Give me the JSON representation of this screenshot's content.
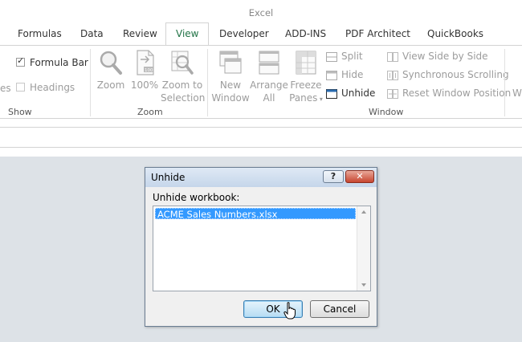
{
  "window": {
    "title": "Excel"
  },
  "tabs": [
    {
      "label": "Formulas"
    },
    {
      "label": "Data"
    },
    {
      "label": "Review"
    },
    {
      "label": "View",
      "active": true
    },
    {
      "label": "Developer"
    },
    {
      "label": "ADD-INS"
    },
    {
      "label": "PDF Architect"
    },
    {
      "label": "QuickBooks"
    }
  ],
  "ribbon": {
    "show": {
      "label": "Show",
      "partial_left": "es",
      "formula_bar": {
        "label": "Formula Bar",
        "checked": true
      },
      "headings": {
        "label": "Headings",
        "checked": false,
        "disabled": true
      }
    },
    "zoom": {
      "label": "Zoom",
      "zoom_btn": {
        "label": "Zoom",
        "icon": "magnifier-icon"
      },
      "hundred_btn": {
        "label": "100%",
        "icon": "zoom-100-icon"
      },
      "selection_btn": {
        "line1": "Zoom to",
        "line2": "Selection",
        "icon": "zoom-selection-icon"
      }
    },
    "window": {
      "label": "Window",
      "new_window": {
        "line1": "New",
        "line2": "Window"
      },
      "arrange_all": {
        "line1": "Arrange",
        "line2": "All"
      },
      "freeze_panes": {
        "line1": "Freeze",
        "line2": "Panes"
      },
      "split": "Split",
      "hide": "Hide",
      "unhide": "Unhide",
      "view_side_by_side": "View Side by Side",
      "synchronous_scrolling": "Synchronous Scrolling",
      "reset_window_position": "Reset Window Position",
      "partial_right": "W"
    }
  },
  "dialog": {
    "title": "Unhide",
    "help_label": "?",
    "close_label": "✕",
    "list_label": "Unhide workbook:",
    "items": [
      "ACME Sales Numbers.xlsx"
    ],
    "ok_label": "OK",
    "cancel_label": "Cancel"
  },
  "colors": {
    "accent": "#217346",
    "selection": "#3399ff",
    "background": "#dde2e7"
  }
}
